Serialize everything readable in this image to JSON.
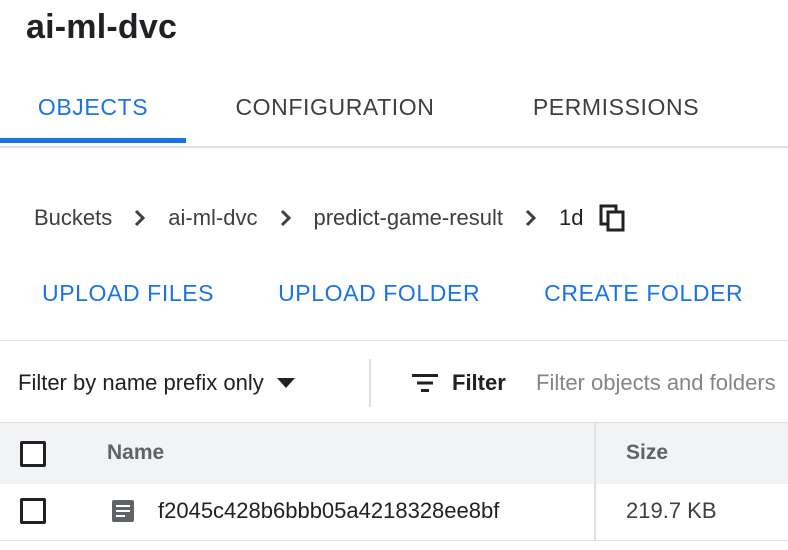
{
  "bucket_title": "ai-ml-dvc",
  "tabs": [
    {
      "label": "OBJECTS",
      "active": true
    },
    {
      "label": "CONFIGURATION",
      "active": false
    },
    {
      "label": "PERMISSIONS",
      "active": false
    }
  ],
  "breadcrumb": {
    "items": [
      "Buckets",
      "ai-ml-dvc",
      "predict-game-result"
    ],
    "current": "1d",
    "separator_icon": "chevron-right-icon",
    "copy_icon": "copy-icon"
  },
  "actions": {
    "upload_files": "UPLOAD FILES",
    "upload_folder": "UPLOAD FOLDER",
    "create_folder": "CREATE FOLDER"
  },
  "filter": {
    "mode_label": "Filter by name prefix only",
    "button_label": "Filter",
    "placeholder": "Filter objects and folders"
  },
  "table": {
    "columns": {
      "name": "Name",
      "size": "Size"
    },
    "rows": [
      {
        "name": "f2045c428b6bbb05a4218328ee8bf",
        "size": "219.7 KB",
        "icon": "file-document-icon",
        "checked": false
      }
    ]
  },
  "colors": {
    "accent": "#1a73e8",
    "text": "#202124",
    "muted": "#5f6368",
    "divider": "#e0e0e0",
    "header_bg": "#f1f3f4"
  }
}
